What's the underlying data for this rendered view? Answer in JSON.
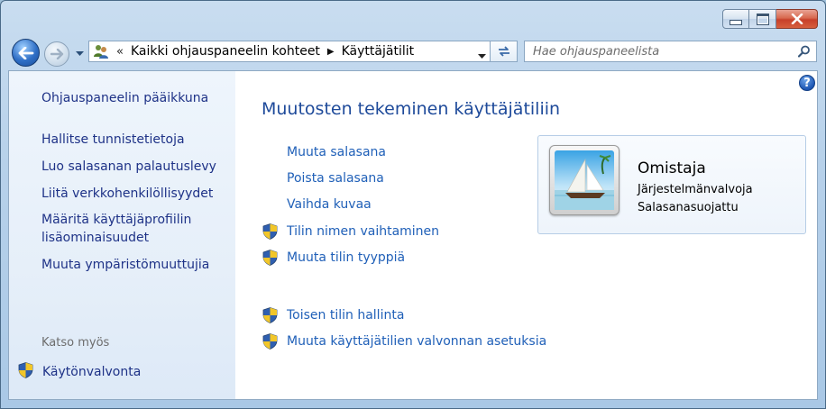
{
  "window": {
    "caption_buttons": [
      "minimize",
      "maximize",
      "close"
    ]
  },
  "navigation": {
    "breadcrumb_overflow": "«",
    "breadcrumb": [
      "Kaikki ohjauspaneelin kohteet",
      "Käyttäjätilit"
    ],
    "search": {
      "placeholder": "Hae ohjauspaneelista",
      "value": ""
    }
  },
  "sidebar": {
    "home": "Ohjauspaneelin pääikkuna",
    "items": [
      "Hallitse tunnistetietoja",
      "Luo salasanan palautuslevy",
      "Liitä verkkohenkilöllisyydet",
      "Määritä käyttäjäprofiilin lisäominaisuudet",
      "Muuta ympäristömuuttujia"
    ],
    "see_also_heading": "Katso myös",
    "see_also": [
      "Käytönvalvonta"
    ]
  },
  "main": {
    "title": "Muutosten tekeminen käyttäjätiliin",
    "tasks": [
      {
        "label": "Muuta salasana",
        "shield": false
      },
      {
        "label": "Poista salasana",
        "shield": false
      },
      {
        "label": "Vaihda kuvaa",
        "shield": false
      },
      {
        "label": "Tilin nimen vaihtaminen",
        "shield": true
      },
      {
        "label": "Muuta tilin tyyppiä",
        "shield": true
      },
      {
        "label": "Toisen tilin hallinta",
        "shield": true
      },
      {
        "label": "Muuta käyttäjätilien valvonnan asetuksia",
        "shield": true
      }
    ],
    "help_label": "?"
  },
  "account": {
    "name": "Omistaja",
    "type": "Järjestelmänvalvoja",
    "password_status": "Salasanasuojattu",
    "picture": "sailboat-picture"
  },
  "colors": {
    "link": "#2060b8",
    "sidebar_link": "#1e3287",
    "title": "#1e4a9a"
  }
}
